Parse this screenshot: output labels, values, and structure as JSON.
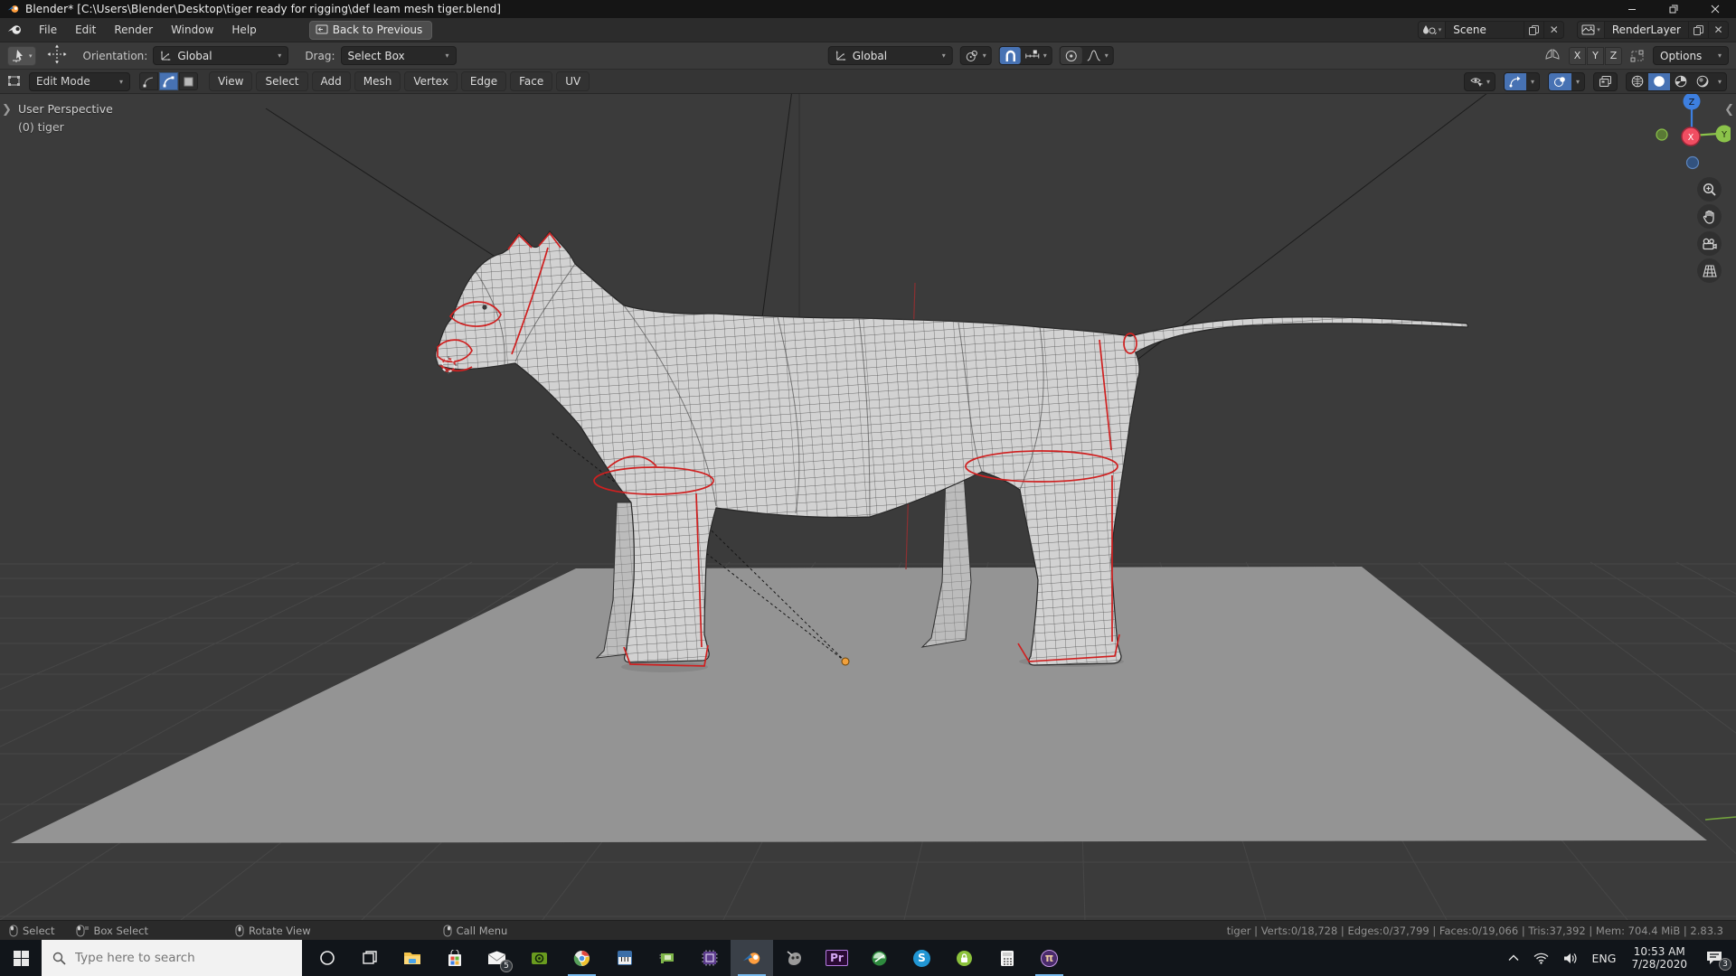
{
  "window": {
    "title": "Blender* [C:\\Users\\Blender\\Desktop\\tiger ready for rigging\\def leam mesh tiger.blend]"
  },
  "menubar": {
    "items": [
      "File",
      "Edit",
      "Render",
      "Window",
      "Help"
    ],
    "back_button": "Back to Previous",
    "scene_value": "Scene",
    "layer_value": "RenderLayer"
  },
  "tool_settings": {
    "orientation_label": "Orientation:",
    "orientation_value": "Global",
    "drag_label": "Drag:",
    "drag_value": "Select Box",
    "transform_orientation": "Global",
    "mirror_x": "X",
    "mirror_y": "Y",
    "mirror_z": "Z",
    "options_label": "Options"
  },
  "viewport_header": {
    "mode": "Edit Mode",
    "menus": [
      "View",
      "Select",
      "Add",
      "Mesh",
      "Vertex",
      "Edge",
      "Face",
      "UV"
    ]
  },
  "viewport": {
    "perspective_label": "User Perspective",
    "object_label": "(0) tiger",
    "axis_x": "X",
    "axis_y": "Y",
    "axis_z": "Z"
  },
  "statusbar": {
    "hints": [
      {
        "label": "Select"
      },
      {
        "label": "Box Select"
      },
      {
        "label": "Rotate View"
      },
      {
        "label": "Call Menu"
      }
    ],
    "stats": "tiger | Verts:0/18,728 | Edges:0/37,799 | Faces:0/19,066 | Tris:37,392 | Mem: 704.4 MiB | 2.83.3"
  },
  "taskbar": {
    "search_placeholder": "Type here to search",
    "mail_badge": "5",
    "premiere_glyph": "Pr",
    "skype_glyph": "S",
    "pi_glyph": "π",
    "language": "ENG",
    "time": "10:53 AM",
    "date": "7/28/2020",
    "notification_badge": "3"
  },
  "colors": {
    "accent": "#4772b3",
    "titlebar_bg": "#151515",
    "menubar_bg": "#2c2c2c",
    "toolbar_bg": "#3a3a3a",
    "header_bg": "#353535",
    "widget_bg": "#282828",
    "viewport_bg": "#3b3b3b",
    "grid_line": "#474747",
    "plane": "#949494",
    "mesh": "#d2d2d2",
    "seam": "#cf2020",
    "origin": "#f0a03c",
    "axisx": "#f14e62",
    "axisy": "#8bc34a",
    "axisz": "#3d7fe0",
    "floor_axis_y": "#73a33e",
    "statusbar_bg": "#2a2a2a",
    "taskbar_bg": "#11151a"
  }
}
